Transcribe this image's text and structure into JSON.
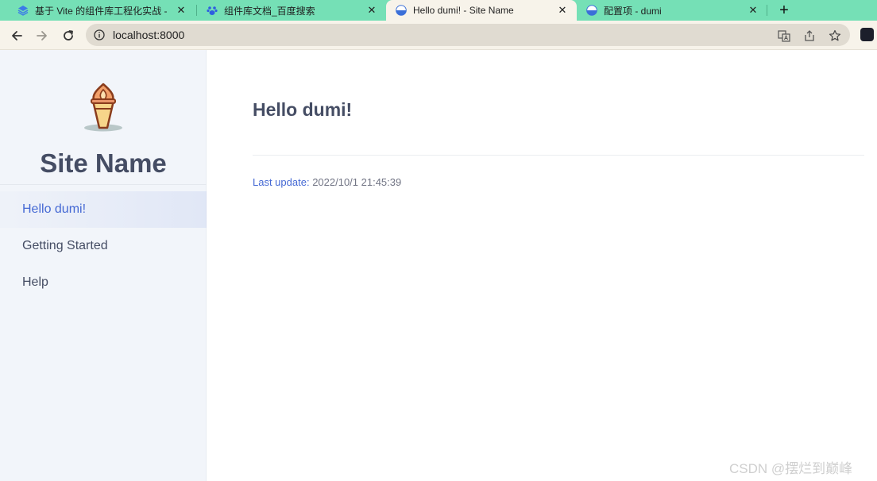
{
  "browser": {
    "tabs": [
      {
        "title": "基于 Vite 的组件库工程化实战 -",
        "favicon": "layers-icon",
        "active": false
      },
      {
        "title": "组件库文档_百度搜索",
        "favicon": "baidu-paw-icon",
        "active": false
      },
      {
        "title": "Hello dumi! - Site Name",
        "favicon": "dumi-globe-icon",
        "active": true
      },
      {
        "title": "配置项 - dumi",
        "favicon": "dumi-globe-icon",
        "active": false
      }
    ],
    "close_glyph": "✕",
    "new_tab_glyph": "+",
    "address": {
      "url": "localhost:8000"
    },
    "colors": {
      "tabstrip": "#75e0b6",
      "toolbar": "#f7f3ea",
      "omnibox": "#e0dbd1"
    }
  },
  "sidebar": {
    "site_name": "Site Name",
    "menu": [
      {
        "label": "Hello dumi!",
        "active": true
      },
      {
        "label": "Getting Started",
        "active": false
      },
      {
        "label": "Help",
        "active": false
      }
    ]
  },
  "main": {
    "title": "Hello dumi!",
    "last_update_label": "Last update:",
    "last_update_value": "2022/10/1 21:45:39"
  },
  "watermark": "CSDN @摆烂到巅峰",
  "colors": {
    "accent": "#4569d4",
    "text": "#454d64",
    "sidebar_bg": "#f2f5fa"
  }
}
